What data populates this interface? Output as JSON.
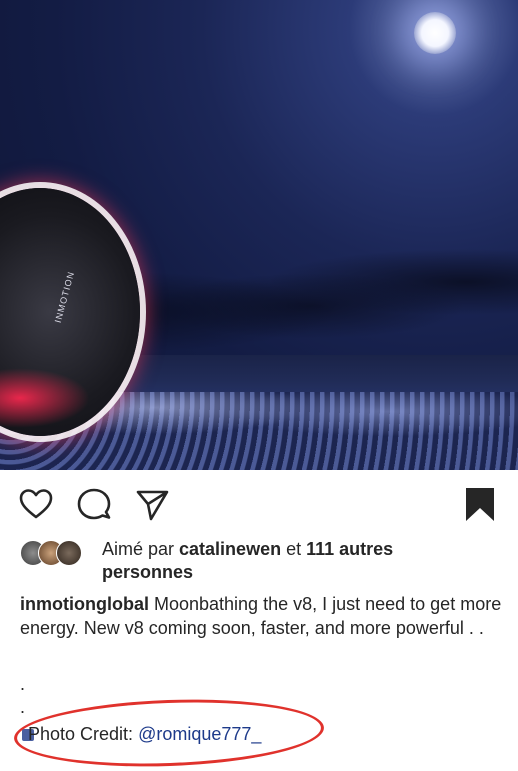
{
  "post": {
    "account": "inmotionglobal",
    "brand_mark": "INMOTION",
    "caption_text": " Moonbathing the v8, I just need to get more  energy. New v8 coming soon, faster, and more powerful . .",
    "dots": [
      ".",
      "."
    ],
    "credit_label": "Photo Credit: ",
    "credit_handle": "@romique777_"
  },
  "likes": {
    "prefix": "Aimé par ",
    "user": "catalinewen",
    "middle": " et ",
    "count": "111 autres",
    "suffix": "personnes"
  },
  "actions": {
    "like_icon": "heart-icon",
    "comment_icon": "comment-icon",
    "share_icon": "send-icon",
    "save_icon": "bookmark-icon"
  },
  "colors": {
    "annotation": "#e0322c",
    "link": "#1d3a8a"
  }
}
